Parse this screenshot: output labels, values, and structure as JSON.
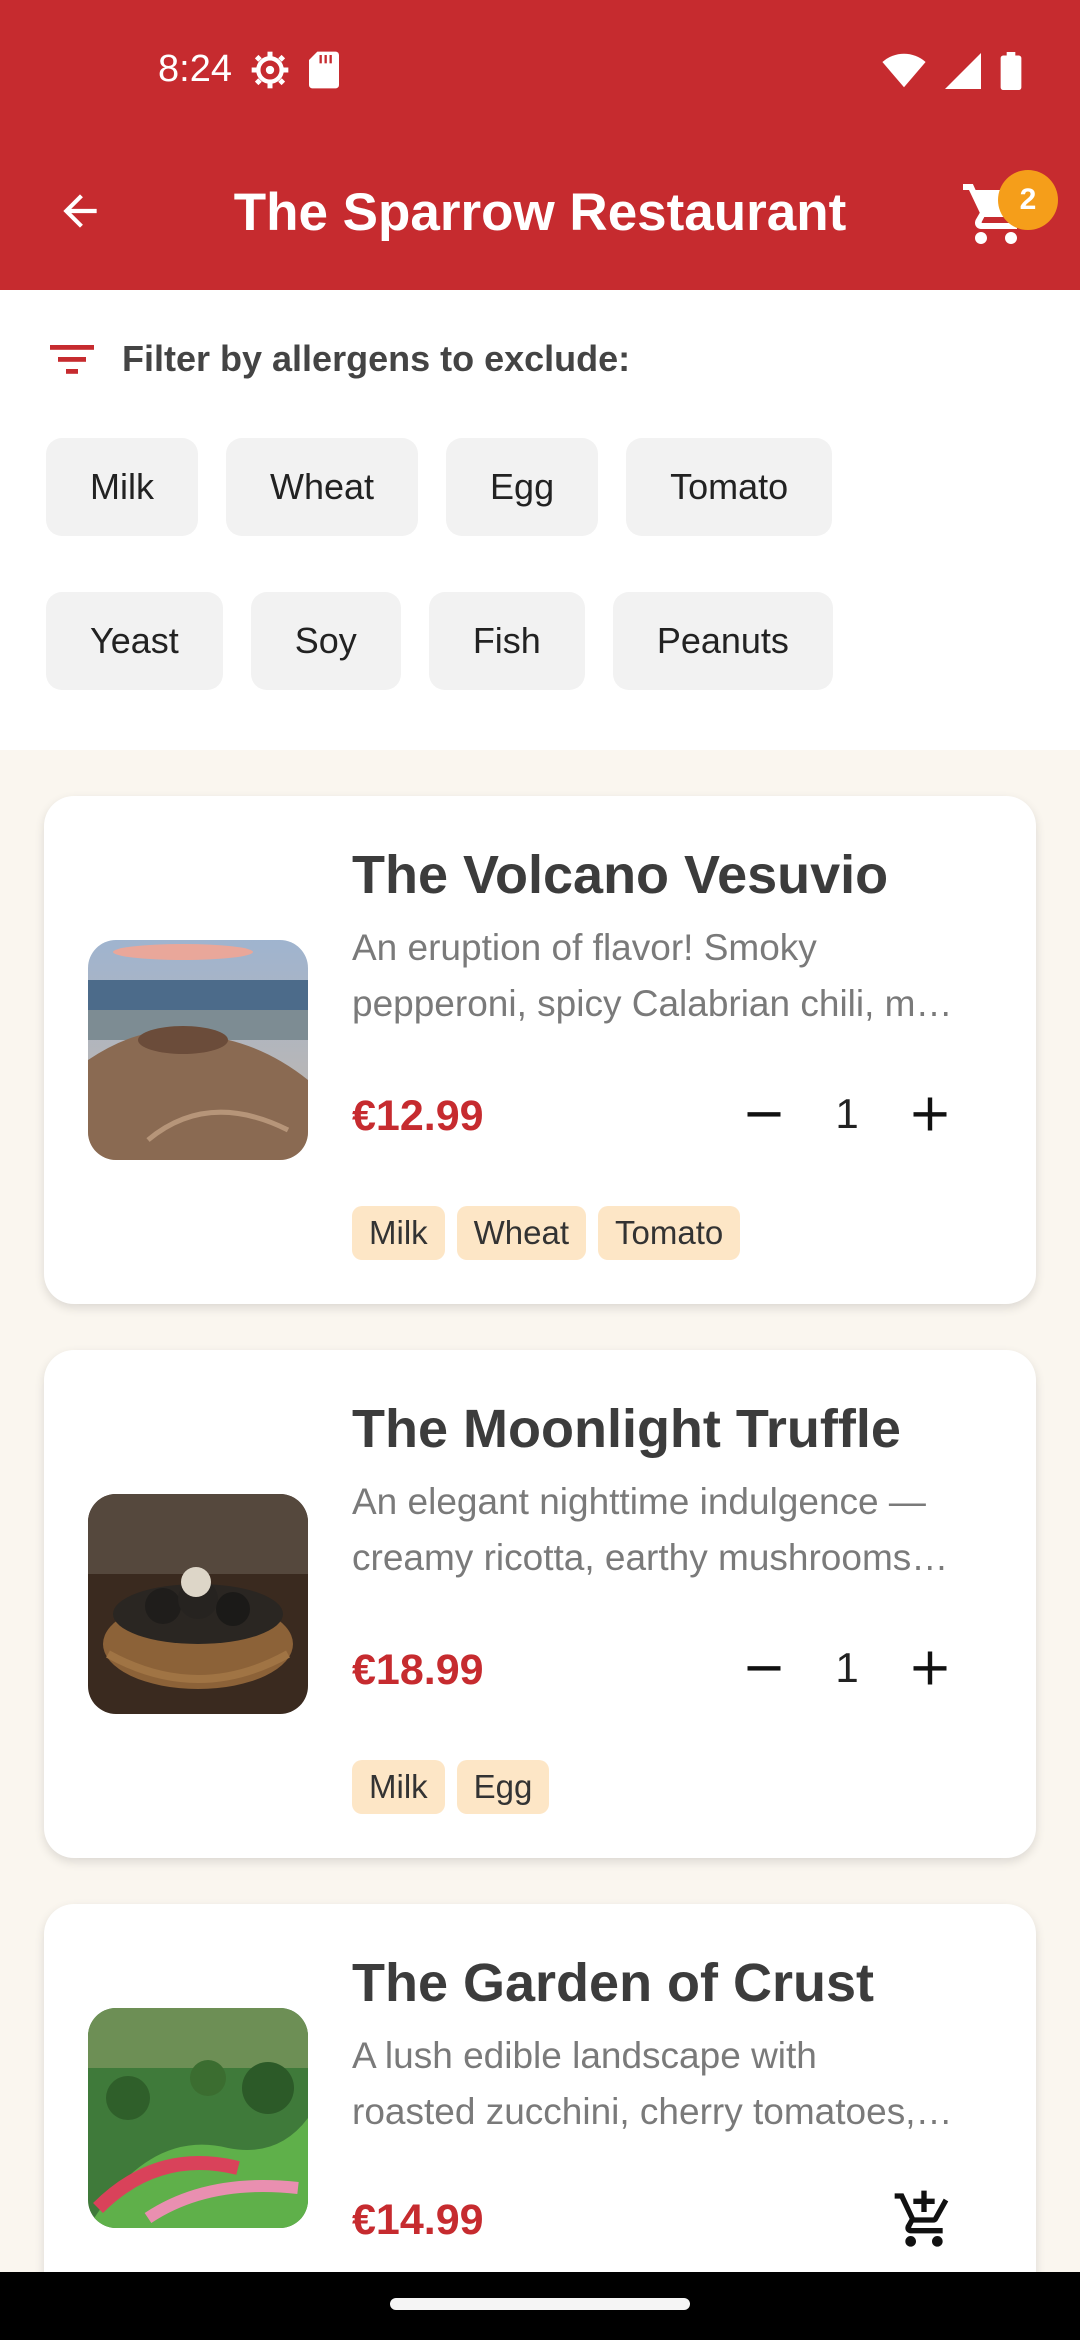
{
  "status_bar": {
    "time": "8:24",
    "icons_left": [
      "gear-icon",
      "sd-card-icon"
    ],
    "icons_right": [
      "wifi-icon",
      "signal-icon",
      "battery-icon"
    ]
  },
  "app_bar": {
    "title": "The Sparrow Restaurant",
    "cart_count": "2",
    "color": "#c62b2f",
    "badge_color": "#f59e1a"
  },
  "filter": {
    "label": "Filter by allergens to exclude:",
    "row1": [
      "Milk",
      "Wheat",
      "Egg",
      "Tomato"
    ],
    "row2": [
      "Yeast",
      "Soy",
      "Fish",
      "Peanuts"
    ]
  },
  "menu": [
    {
      "name": "The Volcano Vesuvio",
      "desc_line1": "An eruption of flavor! Smoky",
      "desc_line2": "pepperoni, spicy Calabrian chili, m…",
      "price": "€12.99",
      "quantity": "1",
      "allergens": [
        "Milk",
        "Wheat",
        "Tomato"
      ]
    },
    {
      "name": "The Moonlight Truffle",
      "desc_line1": "An elegant nighttime indulgence —",
      "desc_line2": "creamy ricotta, earthy mushrooms…",
      "price": "€18.99",
      "quantity": "1",
      "allergens": [
        "Milk",
        "Egg"
      ]
    },
    {
      "name": "The Garden of Crust",
      "desc_line1": "A lush edible landscape with",
      "desc_line2": "roasted zucchini, cherry tomatoes,…",
      "price": "€14.99"
    }
  ]
}
